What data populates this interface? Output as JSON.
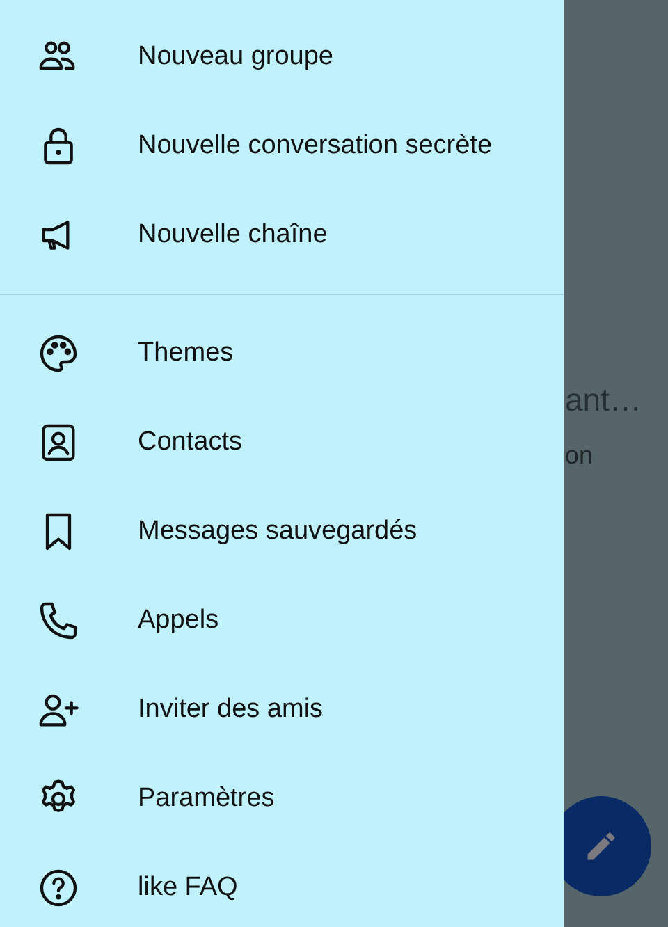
{
  "background": {
    "chat_title": "ant…",
    "chat_subtitle": "on"
  },
  "drawer": {
    "sections": [
      {
        "items": [
          {
            "kind": "group",
            "label": "Nouveau groupe"
          },
          {
            "kind": "lock",
            "label": "Nouvelle conversation secrète"
          },
          {
            "kind": "megaphone",
            "label": "Nouvelle chaîne"
          }
        ]
      },
      {
        "items": [
          {
            "kind": "palette",
            "label": "Themes"
          },
          {
            "kind": "contact",
            "label": "Contacts"
          },
          {
            "kind": "bookmark",
            "label": "Messages sauvegardés"
          },
          {
            "kind": "phone",
            "label": "Appels"
          },
          {
            "kind": "person-add",
            "label": "Inviter des amis"
          },
          {
            "kind": "gear",
            "label": "Paramètres"
          },
          {
            "kind": "help",
            "label": "like FAQ"
          }
        ]
      }
    ]
  }
}
